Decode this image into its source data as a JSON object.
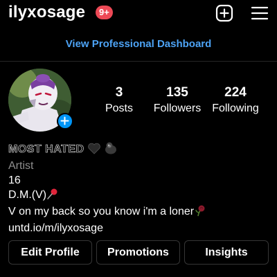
{
  "header": {
    "username": "ilyxosage",
    "notification_badge": "9+",
    "add_icon": "plus-square-icon",
    "menu_icon": "hamburger-menu-icon"
  },
  "dashboard_link": "View Professional Dashboard",
  "profile": {
    "avatar_icon": "avatar-image",
    "avatar_add_icon": "plus-icon",
    "stats": [
      {
        "value": "3",
        "label": "Posts"
      },
      {
        "value": "135",
        "label": "Followers"
      },
      {
        "value": "224",
        "label": "Following"
      }
    ]
  },
  "bio": {
    "name": "MOST HATED",
    "name_emojis": [
      "black-heart-emoji",
      "gorilla-emoji"
    ],
    "category": "Artist",
    "line1": "16",
    "line2": "D.M.(V)",
    "line2_emoji": "pushpin-emoji",
    "line3": "V on my back so you know i'm a loner",
    "line3_emoji": "wilted-rose-emoji",
    "link": "untd.io/m/ilyxosage"
  },
  "buttons": {
    "edit_profile": "Edit Profile",
    "promotions": "Promotions",
    "insights": "Insights"
  },
  "colors": {
    "background": "#000000",
    "link_blue": "#4da3f5",
    "badge_red": "#ed4956",
    "button_border": "#363636",
    "category_grey": "#8e8e8e",
    "add_blue": "#0095f6"
  }
}
